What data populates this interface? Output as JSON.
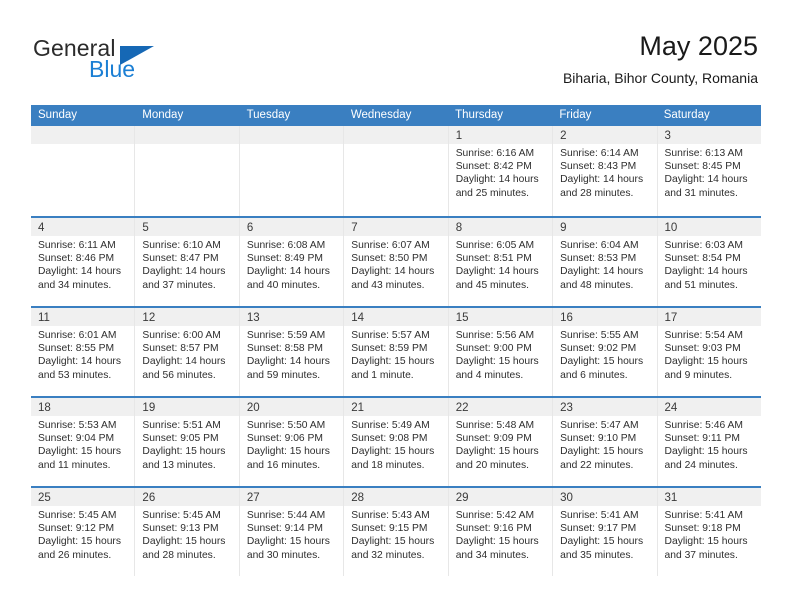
{
  "brand": {
    "name_top": "General",
    "name_bottom": "Blue",
    "accent_color": "#1668b5",
    "blue_text_color": "#1b7fd4"
  },
  "header": {
    "title": "May 2025",
    "subtitle": "Biharia, Bihor County, Romania"
  },
  "calendar": {
    "header_bg": "#3a7fc1",
    "daynum_bg": "#f0f0f0",
    "weekdays": [
      "Sunday",
      "Monday",
      "Tuesday",
      "Wednesday",
      "Thursday",
      "Friday",
      "Saturday"
    ],
    "weeks": [
      [
        {
          "day": "",
          "lines": []
        },
        {
          "day": "",
          "lines": []
        },
        {
          "day": "",
          "lines": []
        },
        {
          "day": "",
          "lines": []
        },
        {
          "day": "1",
          "lines": [
            "Sunrise: 6:16 AM",
            "Sunset: 8:42 PM",
            "Daylight: 14 hours",
            "and 25 minutes."
          ]
        },
        {
          "day": "2",
          "lines": [
            "Sunrise: 6:14 AM",
            "Sunset: 8:43 PM",
            "Daylight: 14 hours",
            "and 28 minutes."
          ]
        },
        {
          "day": "3",
          "lines": [
            "Sunrise: 6:13 AM",
            "Sunset: 8:45 PM",
            "Daylight: 14 hours",
            "and 31 minutes."
          ]
        }
      ],
      [
        {
          "day": "4",
          "lines": [
            "Sunrise: 6:11 AM",
            "Sunset: 8:46 PM",
            "Daylight: 14 hours",
            "and 34 minutes."
          ]
        },
        {
          "day": "5",
          "lines": [
            "Sunrise: 6:10 AM",
            "Sunset: 8:47 PM",
            "Daylight: 14 hours",
            "and 37 minutes."
          ]
        },
        {
          "day": "6",
          "lines": [
            "Sunrise: 6:08 AM",
            "Sunset: 8:49 PM",
            "Daylight: 14 hours",
            "and 40 minutes."
          ]
        },
        {
          "day": "7",
          "lines": [
            "Sunrise: 6:07 AM",
            "Sunset: 8:50 PM",
            "Daylight: 14 hours",
            "and 43 minutes."
          ]
        },
        {
          "day": "8",
          "lines": [
            "Sunrise: 6:05 AM",
            "Sunset: 8:51 PM",
            "Daylight: 14 hours",
            "and 45 minutes."
          ]
        },
        {
          "day": "9",
          "lines": [
            "Sunrise: 6:04 AM",
            "Sunset: 8:53 PM",
            "Daylight: 14 hours",
            "and 48 minutes."
          ]
        },
        {
          "day": "10",
          "lines": [
            "Sunrise: 6:03 AM",
            "Sunset: 8:54 PM",
            "Daylight: 14 hours",
            "and 51 minutes."
          ]
        }
      ],
      [
        {
          "day": "11",
          "lines": [
            "Sunrise: 6:01 AM",
            "Sunset: 8:55 PM",
            "Daylight: 14 hours",
            "and 53 minutes."
          ]
        },
        {
          "day": "12",
          "lines": [
            "Sunrise: 6:00 AM",
            "Sunset: 8:57 PM",
            "Daylight: 14 hours",
            "and 56 minutes."
          ]
        },
        {
          "day": "13",
          "lines": [
            "Sunrise: 5:59 AM",
            "Sunset: 8:58 PM",
            "Daylight: 14 hours",
            "and 59 minutes."
          ]
        },
        {
          "day": "14",
          "lines": [
            "Sunrise: 5:57 AM",
            "Sunset: 8:59 PM",
            "Daylight: 15 hours",
            "and 1 minute."
          ]
        },
        {
          "day": "15",
          "lines": [
            "Sunrise: 5:56 AM",
            "Sunset: 9:00 PM",
            "Daylight: 15 hours",
            "and 4 minutes."
          ]
        },
        {
          "day": "16",
          "lines": [
            "Sunrise: 5:55 AM",
            "Sunset: 9:02 PM",
            "Daylight: 15 hours",
            "and 6 minutes."
          ]
        },
        {
          "day": "17",
          "lines": [
            "Sunrise: 5:54 AM",
            "Sunset: 9:03 PM",
            "Daylight: 15 hours",
            "and 9 minutes."
          ]
        }
      ],
      [
        {
          "day": "18",
          "lines": [
            "Sunrise: 5:53 AM",
            "Sunset: 9:04 PM",
            "Daylight: 15 hours",
            "and 11 minutes."
          ]
        },
        {
          "day": "19",
          "lines": [
            "Sunrise: 5:51 AM",
            "Sunset: 9:05 PM",
            "Daylight: 15 hours",
            "and 13 minutes."
          ]
        },
        {
          "day": "20",
          "lines": [
            "Sunrise: 5:50 AM",
            "Sunset: 9:06 PM",
            "Daylight: 15 hours",
            "and 16 minutes."
          ]
        },
        {
          "day": "21",
          "lines": [
            "Sunrise: 5:49 AM",
            "Sunset: 9:08 PM",
            "Daylight: 15 hours",
            "and 18 minutes."
          ]
        },
        {
          "day": "22",
          "lines": [
            "Sunrise: 5:48 AM",
            "Sunset: 9:09 PM",
            "Daylight: 15 hours",
            "and 20 minutes."
          ]
        },
        {
          "day": "23",
          "lines": [
            "Sunrise: 5:47 AM",
            "Sunset: 9:10 PM",
            "Daylight: 15 hours",
            "and 22 minutes."
          ]
        },
        {
          "day": "24",
          "lines": [
            "Sunrise: 5:46 AM",
            "Sunset: 9:11 PM",
            "Daylight: 15 hours",
            "and 24 minutes."
          ]
        }
      ],
      [
        {
          "day": "25",
          "lines": [
            "Sunrise: 5:45 AM",
            "Sunset: 9:12 PM",
            "Daylight: 15 hours",
            "and 26 minutes."
          ]
        },
        {
          "day": "26",
          "lines": [
            "Sunrise: 5:45 AM",
            "Sunset: 9:13 PM",
            "Daylight: 15 hours",
            "and 28 minutes."
          ]
        },
        {
          "day": "27",
          "lines": [
            "Sunrise: 5:44 AM",
            "Sunset: 9:14 PM",
            "Daylight: 15 hours",
            "and 30 minutes."
          ]
        },
        {
          "day": "28",
          "lines": [
            "Sunrise: 5:43 AM",
            "Sunset: 9:15 PM",
            "Daylight: 15 hours",
            "and 32 minutes."
          ]
        },
        {
          "day": "29",
          "lines": [
            "Sunrise: 5:42 AM",
            "Sunset: 9:16 PM",
            "Daylight: 15 hours",
            "and 34 minutes."
          ]
        },
        {
          "day": "30",
          "lines": [
            "Sunrise: 5:41 AM",
            "Sunset: 9:17 PM",
            "Daylight: 15 hours",
            "and 35 minutes."
          ]
        },
        {
          "day": "31",
          "lines": [
            "Sunrise: 5:41 AM",
            "Sunset: 9:18 PM",
            "Daylight: 15 hours",
            "and 37 minutes."
          ]
        }
      ]
    ]
  }
}
